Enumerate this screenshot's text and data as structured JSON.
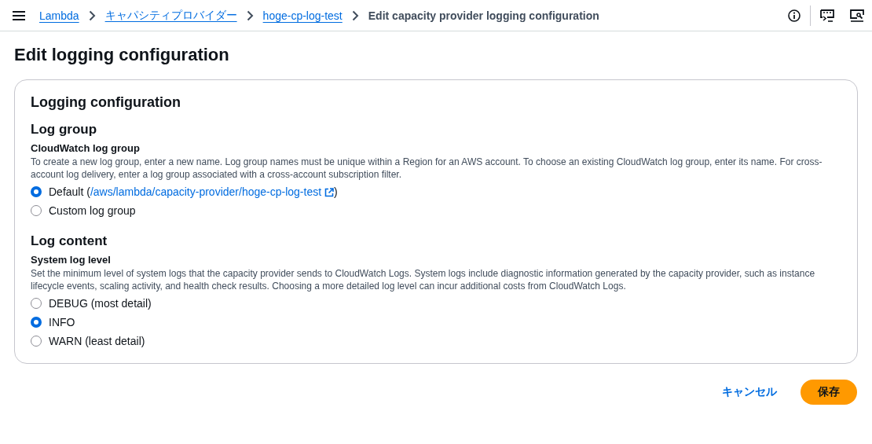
{
  "breadcrumbs": [
    {
      "label": "Lambda",
      "link": true
    },
    {
      "label": "キャパシティプロバイダー",
      "link": true
    },
    {
      "label": "hoge-cp-log-test",
      "link": true
    },
    {
      "label": "Edit capacity provider logging configuration",
      "link": false
    }
  ],
  "page_title": "Edit logging configuration",
  "panel": {
    "title": "Logging configuration",
    "sections": [
      {
        "heading": "Log group",
        "field_label": "CloudWatch log group",
        "description": "To create a new log group, enter a new name. Log group names must be unique within a Region for an AWS account. To choose an existing CloudWatch log group, enter its name. For cross-account log delivery, enter a log group associated with a cross-account subscription filter.",
        "options": [
          {
            "label": "Default (",
            "link": "/aws/lambda/capacity-provider/hoge-cp-log-test",
            "suffix": ")",
            "selected": true
          },
          {
            "label": "Custom log group",
            "selected": false
          }
        ]
      },
      {
        "heading": "Log content",
        "field_label": "System log level",
        "description": "Set the minimum level of system logs that the capacity provider sends to CloudWatch Logs. System logs include diagnostic information generated by the capacity provider, such as instance lifecycle events, scaling activity, and health check results. Choosing a more detailed log level can incur additional costs from CloudWatch Logs.",
        "options": [
          {
            "label": "DEBUG (most detail)",
            "selected": false
          },
          {
            "label": "INFO",
            "selected": true
          },
          {
            "label": "WARN (least detail)",
            "selected": false
          }
        ]
      }
    ]
  },
  "actions": {
    "cancel": "キャンセル",
    "save": "保存"
  }
}
